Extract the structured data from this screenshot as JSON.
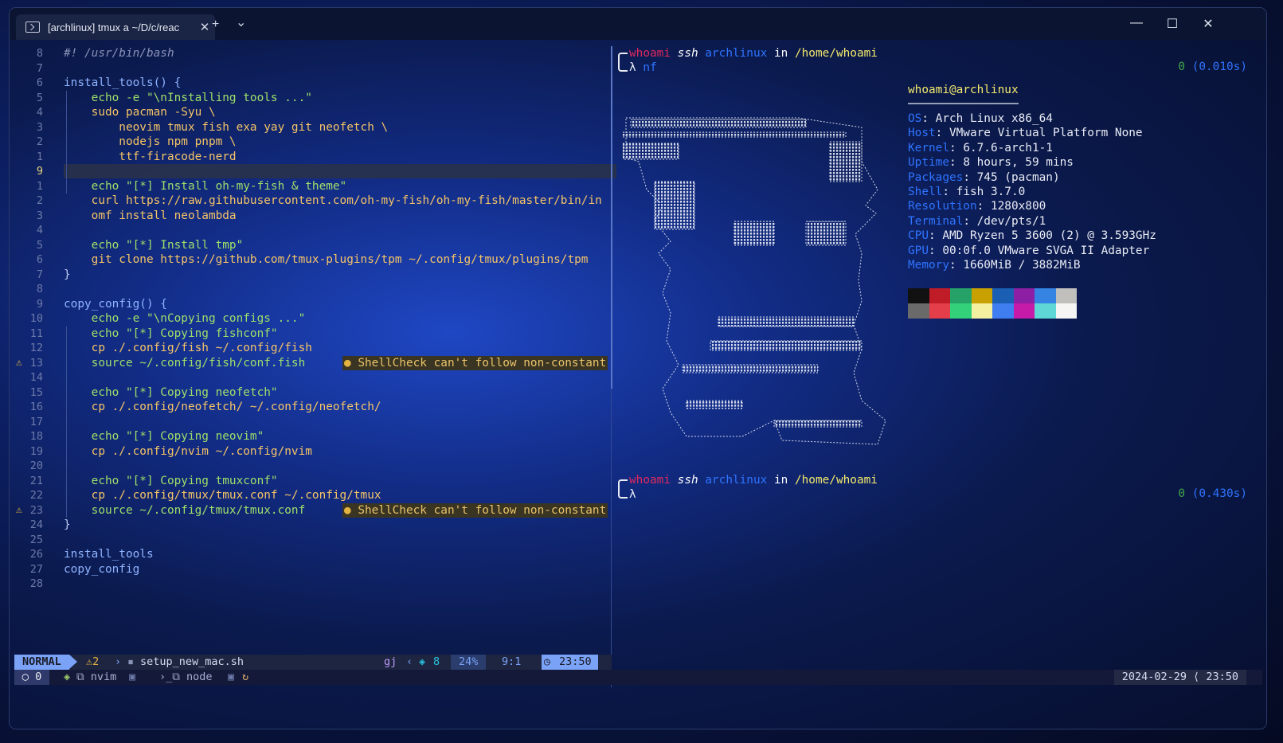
{
  "window": {
    "tab_title": "[archlinux] tmux a ~/D/c/reac",
    "new_tab": "+",
    "tab_dropdown": "⌄",
    "minimize": "—",
    "maximize": "☐",
    "close": "✕"
  },
  "editor": {
    "lines": [
      {
        "num": "8",
        "text": "#! /usr/bin/bash"
      },
      {
        "num": "7",
        "text": ""
      },
      {
        "num": "6",
        "text": "install_tools() {"
      },
      {
        "num": "5",
        "text": "    echo -e \"\\nInstalling tools ...\""
      },
      {
        "num": "4",
        "text": "    sudo pacman -Syu \\"
      },
      {
        "num": "3",
        "text": "        neovim tmux fish exa yay git neofetch \\"
      },
      {
        "num": "2",
        "text": "        nodejs npm pnpm \\"
      },
      {
        "num": "1",
        "text": "        ttf-firacode-nerd"
      },
      {
        "num": "9",
        "text": ""
      },
      {
        "num": "1",
        "text": "    echo \"[*] Install oh-my-fish & theme\""
      },
      {
        "num": "2",
        "text": "    curl https://raw.githubusercontent.com/oh-my-fish/oh-my-fish/master/bin/in"
      },
      {
        "num": "3",
        "text": "    omf install neolambda"
      },
      {
        "num": "4",
        "text": ""
      },
      {
        "num": "5",
        "text": "    echo \"[*] Install tmp\""
      },
      {
        "num": "6",
        "text": "    git clone https://github.com/tmux-plugins/tpm ~/.config/tmux/plugins/tpm"
      },
      {
        "num": "7",
        "text": "}"
      },
      {
        "num": "8",
        "text": ""
      },
      {
        "num": "9",
        "text": "copy_config() {"
      },
      {
        "num": "10",
        "text": "    echo -e \"\\nCopying configs ...\""
      },
      {
        "num": "11",
        "text": "    echo \"[*] Copying fishconf\""
      },
      {
        "num": "12",
        "text": "    cp ./.config/fish ~/.config/fish"
      },
      {
        "num": "13",
        "text": "    source ~/.config/fish/conf.fish"
      },
      {
        "num": "14",
        "text": ""
      },
      {
        "num": "15",
        "text": "    echo \"[*] Copying neofetch\""
      },
      {
        "num": "16",
        "text": "    cp ./.config/neofetch/ ~/.config/neofetch/"
      },
      {
        "num": "17",
        "text": ""
      },
      {
        "num": "18",
        "text": "    echo \"[*] Copying neovim\""
      },
      {
        "num": "19",
        "text": "    cp ./.config/nvim ~/.config/nvim"
      },
      {
        "num": "20",
        "text": ""
      },
      {
        "num": "21",
        "text": "    echo \"[*] Copying tmuxconf\""
      },
      {
        "num": "22",
        "text": "    cp ./.config/tmux/tmux.conf ~/.config/tmux"
      },
      {
        "num": "23",
        "text": "    source ~/.config/tmux/tmux.conf"
      },
      {
        "num": "24",
        "text": "}"
      },
      {
        "num": "25",
        "text": ""
      },
      {
        "num": "26",
        "text": "install_tools"
      },
      {
        "num": "27",
        "text": "copy_config"
      },
      {
        "num": "28",
        "text": ""
      }
    ],
    "diagnostic_text": "ShellCheck can't follow non-constant",
    "warning_icon": "⚠"
  },
  "nvim_status": {
    "mode": "NORMAL",
    "warnings": "⚠2",
    "filename": "setup_new_mac.sh",
    "keys": "gj",
    "lsp_count": "8",
    "percent": "24%",
    "position": "9:1",
    "time": "23:50"
  },
  "tmux": {
    "session": "0",
    "window1": "nvim",
    "window2": "node",
    "datetime": "2024-02-29 ⟨ 23:50"
  },
  "terminal": {
    "prompt1": {
      "user": "whoami",
      "ssh": "ssh",
      "host": "archlinux",
      "in": "in",
      "path": "/home/whoami",
      "lambda": "λ",
      "cmd": "nf",
      "status": "0",
      "time": "(0.010s)"
    },
    "prompt2": {
      "user": "whoami",
      "ssh": "ssh",
      "host": "archlinux",
      "in": "in",
      "path": "/home/whoami",
      "lambda": "λ",
      "status": "0",
      "time": "(0.430s)"
    },
    "neofetch": {
      "userhost": "whoami@archlinux",
      "separator": "────────────────",
      "fields": [
        {
          "k": "OS",
          "v": "Arch Linux x86_64"
        },
        {
          "k": "Host",
          "v": "VMware Virtual Platform None"
        },
        {
          "k": "Kernel",
          "v": "6.7.6-arch1-1"
        },
        {
          "k": "Uptime",
          "v": "8 hours, 59 mins"
        },
        {
          "k": "Packages",
          "v": "745 (pacman)"
        },
        {
          "k": "Shell",
          "v": "fish 3.7.0"
        },
        {
          "k": "Resolution",
          "v": "1280x800"
        },
        {
          "k": "Terminal",
          "v": "/dev/pts/1"
        },
        {
          "k": "CPU",
          "v": "AMD Ryzen 5 3600 (2) @ 3.593GHz"
        },
        {
          "k": "GPU",
          "v": "00:0f.0 VMware SVGA II Adapter"
        },
        {
          "k": "Memory",
          "v": "1660MiB / 3882MiB"
        }
      ],
      "palette_top": [
        "#111111",
        "#c01c28",
        "#26a269",
        "#c8a000",
        "#1a5fb4",
        "#8c1fa3",
        "#3584e4",
        "#c0bfbc"
      ],
      "palette_bottom": [
        "#6a6a6a",
        "#e43e4a",
        "#33d17a",
        "#f5f0a0",
        "#3f7ef0",
        "#c61aa8",
        "#5fd7d7",
        "#f6f5f4"
      ]
    }
  }
}
